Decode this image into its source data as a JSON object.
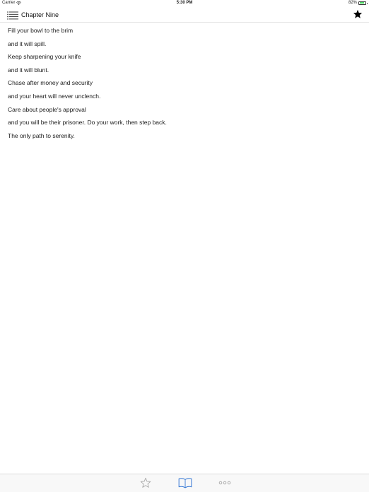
{
  "status_bar": {
    "carrier": "Carrier",
    "time": "5:30 PM",
    "battery_text": "82%",
    "battery_level": 0.82,
    "battery_color": "#4cd964"
  },
  "nav_bar": {
    "menu_icon": "list-icon",
    "title": "Chapter Nine",
    "favorite_icon": "star-filled-icon"
  },
  "content": {
    "lines": [
      "Fill your bowl to the brim",
      "and it will spill.",
      "Keep sharpening your knife",
      "and it will blunt.",
      "Chase after money and security",
      "and your heart will never unclench.",
      "Care about people's approval",
      "and you will be their prisoner. Do your work, then step back.",
      "The only path to serenity."
    ]
  },
  "tab_bar": {
    "tabs": [
      {
        "icon": "star-outline-icon",
        "selected": false
      },
      {
        "icon": "book-icon",
        "selected": true
      },
      {
        "icon": "more-icon",
        "selected": false
      }
    ],
    "active_color": "#3a7bd5",
    "inactive_color": "#a6a6a6"
  }
}
